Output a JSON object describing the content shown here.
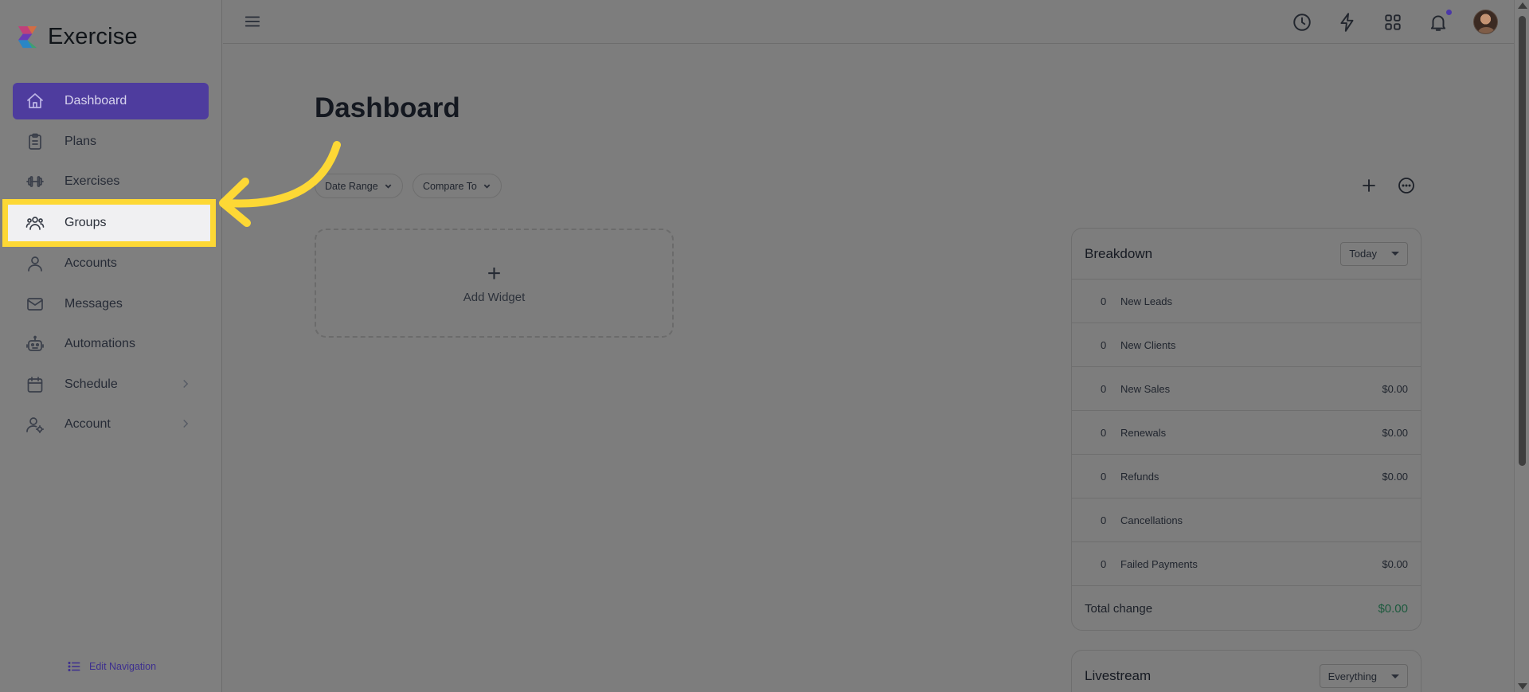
{
  "brand": {
    "name": "Exercise"
  },
  "sidebar": {
    "items": [
      {
        "label": "Dashboard",
        "icon": "home-icon",
        "active": true
      },
      {
        "label": "Plans",
        "icon": "clipboard-icon"
      },
      {
        "label": "Exercises",
        "icon": "dumbbell-icon"
      },
      {
        "label": "Groups",
        "icon": "users-icon",
        "highlighted": true
      },
      {
        "label": "Accounts",
        "icon": "user-icon"
      },
      {
        "label": "Messages",
        "icon": "mail-icon"
      },
      {
        "label": "Automations",
        "icon": "robot-icon"
      },
      {
        "label": "Schedule",
        "icon": "calendar-icon",
        "has_submenu": true
      },
      {
        "label": "Account",
        "icon": "user-gear-icon",
        "has_submenu": true
      }
    ],
    "edit_nav_label": "Edit Navigation"
  },
  "topbar": {
    "icons": [
      "history-icon",
      "lightning-icon",
      "apps-grid-icon",
      "bell-icon",
      "avatar"
    ]
  },
  "main": {
    "title": "Dashboard",
    "filters": {
      "date_range": "Date Range",
      "compare_to": "Compare To"
    },
    "add_widget_label": "Add Widget"
  },
  "breakdown": {
    "title": "Breakdown",
    "period": "Today",
    "rows": [
      {
        "count": "0",
        "label": "New Leads",
        "amount": ""
      },
      {
        "count": "0",
        "label": "New Clients",
        "amount": ""
      },
      {
        "count": "0",
        "label": "New Sales",
        "amount": "$0.00"
      },
      {
        "count": "0",
        "label": "Renewals",
        "amount": "$0.00"
      },
      {
        "count": "0",
        "label": "Refunds",
        "amount": "$0.00"
      },
      {
        "count": "0",
        "label": "Cancellations",
        "amount": ""
      },
      {
        "count": "0",
        "label": "Failed Payments",
        "amount": "$0.00"
      }
    ],
    "total_label": "Total change",
    "total_amount": "$0.00"
  },
  "livestream": {
    "title": "Livestream",
    "filter": "Everything"
  },
  "colors": {
    "accent": "#4e3c9e",
    "highlight": "#fdd835",
    "positive": "#1d5a3e"
  }
}
